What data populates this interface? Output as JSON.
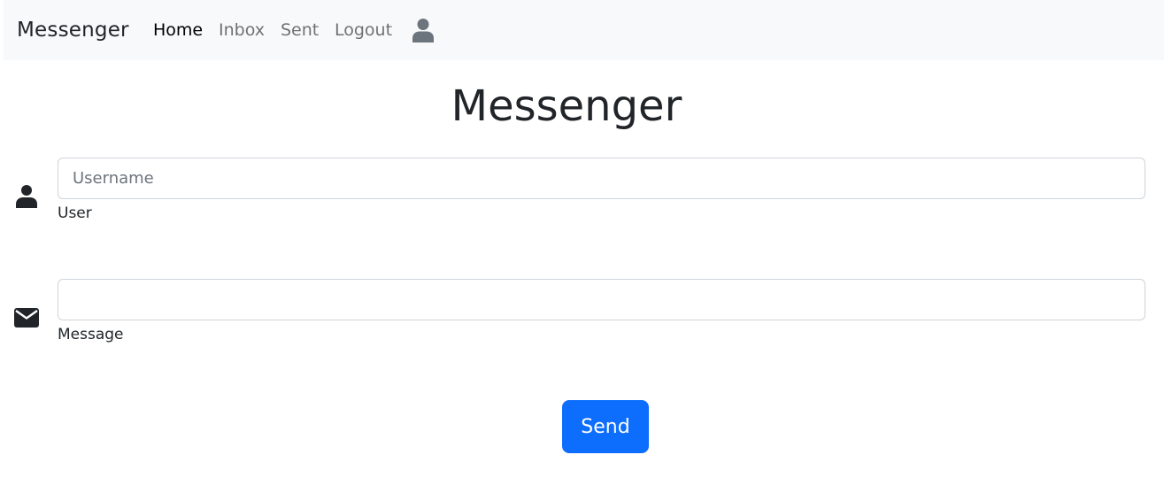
{
  "navbar": {
    "brand": "Messenger",
    "links": [
      {
        "label": "Home",
        "active": true
      },
      {
        "label": "Inbox",
        "active": false
      },
      {
        "label": "Sent",
        "active": false
      },
      {
        "label": "Logout",
        "active": false
      }
    ],
    "user_icon": "user-icon"
  },
  "main": {
    "title": "Messenger",
    "user_field": {
      "icon": "user-icon",
      "placeholder": "Username",
      "value": "",
      "label": "User"
    },
    "message_field": {
      "icon": "envelope-icon",
      "placeholder": "",
      "value": "",
      "label": "Message"
    },
    "send_label": "Send"
  },
  "colors": {
    "navbar_bg": "#f8f9fa",
    "primary": "#0d6efd",
    "text": "#212529",
    "muted_link": "#8c8c8c",
    "border": "#ced4da"
  }
}
